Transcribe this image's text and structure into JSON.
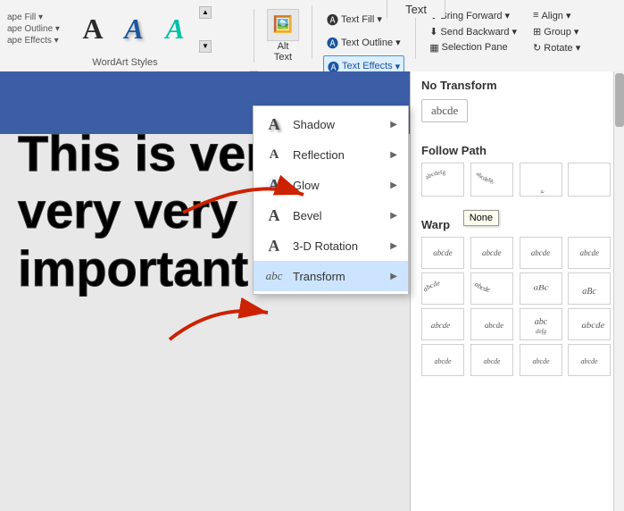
{
  "ribbon": {
    "wordart_label": "WordArt Styles",
    "text_tab": "Text",
    "buttons": {
      "text_effects": "Text Effects",
      "selection_pane": "Selection Pane"
    }
  },
  "dropdown": {
    "items": [
      {
        "id": "shadow",
        "label": "Shadow",
        "icon": "A"
      },
      {
        "id": "reflection",
        "label": "Reflection",
        "icon": "A"
      },
      {
        "id": "glow",
        "label": "Glow",
        "icon": "A"
      },
      {
        "id": "bevel",
        "label": "Bevel",
        "icon": "A"
      },
      {
        "id": "3d-rotation",
        "label": "3-D Rotation",
        "icon": "A"
      },
      {
        "id": "transform",
        "label": "Transform",
        "icon": "abc"
      }
    ]
  },
  "right_panel": {
    "no_transform_title": "No Transform",
    "no_transform_sample": "abcde",
    "follow_path_title": "Follow Path",
    "warp_title": "Warp",
    "none_tooltip": "None",
    "warp_items": [
      "abcde",
      "abcde",
      "abcde",
      "abcde",
      "abcde",
      "abcde",
      "aBc",
      "aBc",
      "abcde",
      "abcde",
      "abc",
      "abcde",
      "abcde",
      "abcde",
      "abcde",
      "abcde"
    ]
  },
  "slide": {
    "main_text_line1": "This is very",
    "main_text_line2": "very very",
    "main_text_line3": "important tex"
  },
  "arrows": {
    "arrow1_direction": "points to right panel no-transform",
    "arrow2_direction": "points to transform menu item"
  }
}
